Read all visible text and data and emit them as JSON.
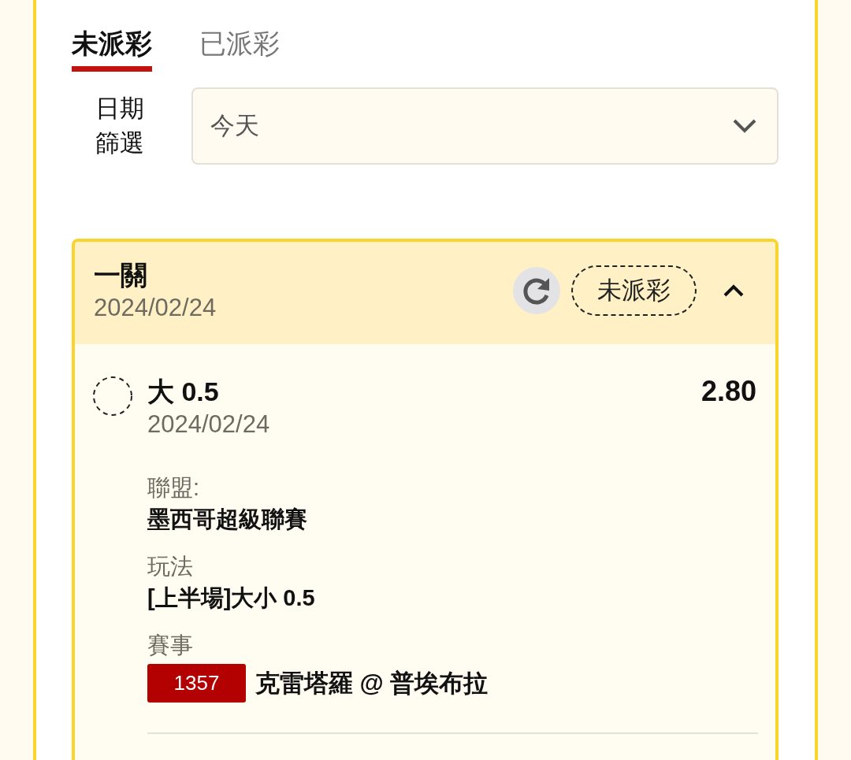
{
  "tabs": [
    {
      "label": "未派彩",
      "selected": true
    },
    {
      "label": "已派彩",
      "selected": false
    }
  ],
  "date_filter": {
    "label": "日期篩選",
    "value": "今天"
  },
  "bets": [
    {
      "title": "一關",
      "date": "2024/02/24",
      "status": "未派彩",
      "expanded": true,
      "selections": [
        {
          "pick": "大 0.5",
          "date": "2024/02/24",
          "odds": "2.80",
          "details": [
            {
              "kind": "text",
              "label": "聯盟:",
              "value": "墨西哥超級聯賽"
            },
            {
              "kind": "text",
              "label": "玩法",
              "value": "[上半場]大小 0.5"
            },
            {
              "kind": "match",
              "label": "賽事",
              "match_no": "1357",
              "value": "克雷塔羅 @ 普埃布拉"
            }
          ]
        }
      ]
    }
  ]
}
